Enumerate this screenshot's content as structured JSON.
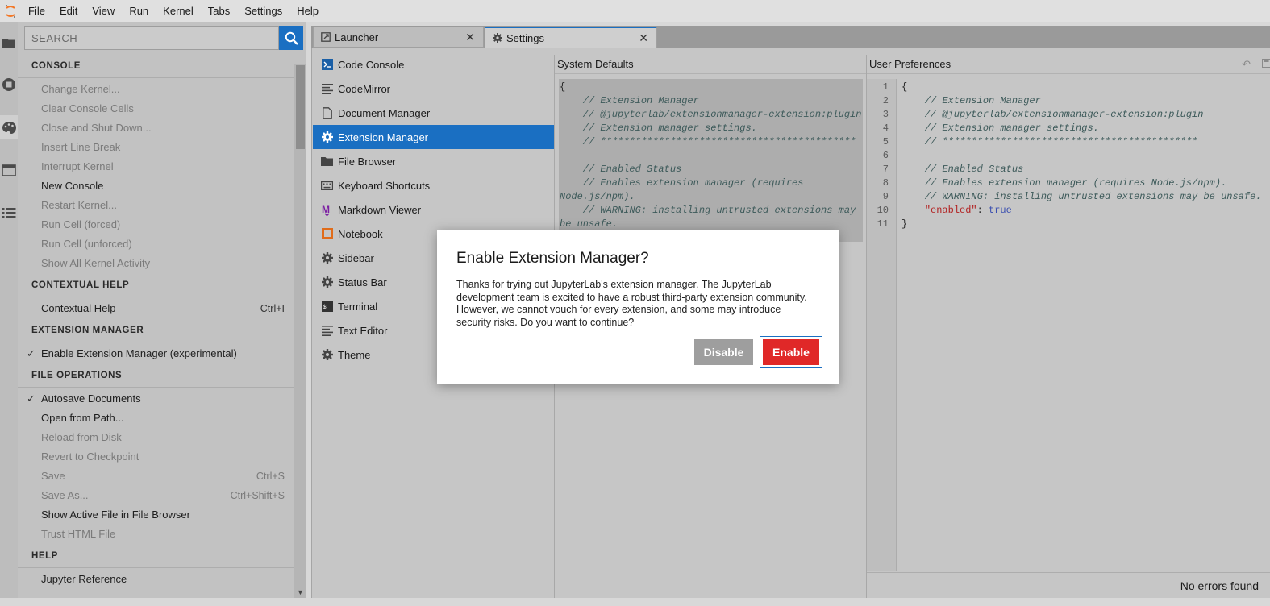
{
  "menubar": {
    "items": [
      "File",
      "Edit",
      "View",
      "Run",
      "Kernel",
      "Tabs",
      "Settings",
      "Help"
    ]
  },
  "rail": {
    "icons": [
      "folder-icon",
      "running-sessions-icon",
      "palette-icon",
      "tabs-icon",
      "toc-icon"
    ]
  },
  "palette": {
    "search_placeholder": "SEARCH",
    "categories": [
      {
        "name": "CONSOLE",
        "items": [
          {
            "label": "Change Kernel...",
            "disabled": true
          },
          {
            "label": "Clear Console Cells",
            "disabled": true
          },
          {
            "label": "Close and Shut Down...",
            "disabled": true
          },
          {
            "label": "Insert Line Break",
            "disabled": true
          },
          {
            "label": "Interrupt Kernel",
            "disabled": true
          },
          {
            "label": "New Console",
            "disabled": false
          },
          {
            "label": "Restart Kernel...",
            "disabled": true
          },
          {
            "label": "Run Cell (forced)",
            "disabled": true
          },
          {
            "label": "Run Cell (unforced)",
            "disabled": true
          },
          {
            "label": "Show All Kernel Activity",
            "disabled": true
          }
        ]
      },
      {
        "name": "CONTEXTUAL HELP",
        "items": [
          {
            "label": "Contextual Help",
            "shortcut": "Ctrl+I",
            "disabled": false
          }
        ]
      },
      {
        "name": "EXTENSION MANAGER",
        "items": [
          {
            "label": "Enable Extension Manager (experimental)",
            "checked": true,
            "disabled": false
          }
        ]
      },
      {
        "name": "FILE OPERATIONS",
        "items": [
          {
            "label": "Autosave Documents",
            "checked": true,
            "disabled": false
          },
          {
            "label": "Open from Path...",
            "disabled": false
          },
          {
            "label": "Reload from Disk",
            "disabled": true
          },
          {
            "label": "Revert to Checkpoint",
            "disabled": true
          },
          {
            "label": "Save",
            "shortcut": "Ctrl+S",
            "disabled": true
          },
          {
            "label": "Save As...",
            "shortcut": "Ctrl+Shift+S",
            "disabled": true
          },
          {
            "label": "Show Active File in File Browser",
            "disabled": false
          },
          {
            "label": "Trust HTML File",
            "disabled": true
          }
        ]
      },
      {
        "name": "HELP",
        "items": [
          {
            "label": "Jupyter Reference",
            "disabled": false
          }
        ]
      }
    ]
  },
  "tabs": [
    {
      "label": "Launcher",
      "icon": "launcher-icon",
      "active": false
    },
    {
      "label": "Settings",
      "icon": "gear-icon",
      "active": true
    }
  ],
  "plugins": [
    {
      "label": "Code Console",
      "icon": "console-icon"
    },
    {
      "label": "CodeMirror",
      "icon": "text-lines-icon"
    },
    {
      "label": "Document Manager",
      "icon": "document-icon"
    },
    {
      "label": "Extension Manager",
      "icon": "gear-icon",
      "active": true
    },
    {
      "label": "File Browser",
      "icon": "folder-icon"
    },
    {
      "label": "Keyboard Shortcuts",
      "icon": "keyboard-icon"
    },
    {
      "label": "Markdown Viewer",
      "icon": "markdown-icon"
    },
    {
      "label": "Notebook",
      "icon": "notebook-icon"
    },
    {
      "label": "Sidebar",
      "icon": "gear-icon"
    },
    {
      "label": "Status Bar",
      "icon": "gear-icon"
    },
    {
      "label": "Terminal",
      "icon": "terminal-icon"
    },
    {
      "label": "Text Editor",
      "icon": "text-lines-icon"
    },
    {
      "label": "Theme",
      "icon": "gear-icon"
    }
  ],
  "system_defaults": {
    "title": "System Defaults",
    "lines": [
      "{",
      "    // Extension Manager",
      "    // @jupyterlab/extensionmanager-extension:plugin",
      "    // Extension manager settings.",
      "    // ********************************************",
      "",
      "    // Enabled Status",
      "    // Enables extension manager (requires",
      "Node.js/npm).",
      "    // WARNING: installing untrusted extensions may",
      "be unsafe."
    ]
  },
  "user_preferences": {
    "title": "User Preferences",
    "line_numbers": [
      "1",
      "2",
      "3",
      "4",
      "5",
      "6",
      "7",
      "8",
      "9",
      "10",
      "11"
    ],
    "lines": [
      "{",
      "    // Extension Manager",
      "    // @jupyterlab/extensionmanager-extension:plugin",
      "    // Extension manager settings.",
      "    // ********************************************",
      "",
      "    // Enabled Status",
      "    // Enables extension manager (requires Node.js/npm).",
      "    // WARNING: installing untrusted extensions may be unsafe.",
      "    \"enabled\": true",
      "}"
    ],
    "enabled_key": "\"enabled\"",
    "enabled_value": "true",
    "status": "No errors found"
  },
  "dialog": {
    "title": "Enable Extension Manager?",
    "body": "Thanks for trying out JupyterLab's extension manager. The JupyterLab development team is excited to have a robust third-party extension community. However, we cannot vouch for every extension, and some may introduce security risks. Do you want to continue?",
    "disable_label": "Disable",
    "enable_label": "Enable"
  },
  "colors": {
    "accent": "#1a6fc2",
    "danger": "#e02828",
    "logo": "#f37726"
  }
}
